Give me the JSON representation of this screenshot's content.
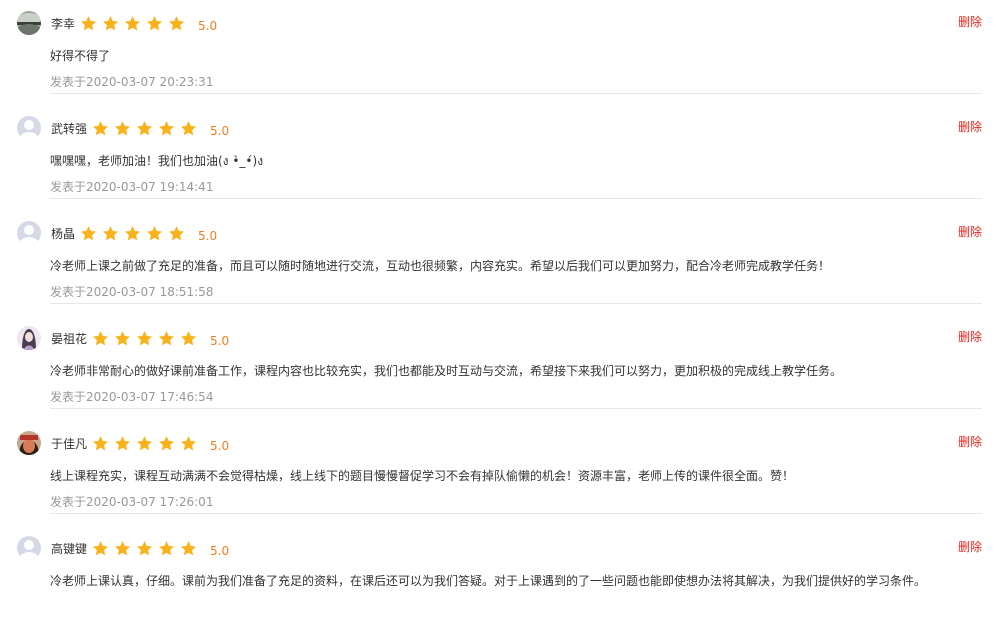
{
  "colors": {
    "star": "#f8b21c",
    "score": "#f07e22",
    "delete": "#e0251c",
    "meta": "#999999",
    "divider": "#e8e8e8"
  },
  "icons": {
    "rating": "star-icon",
    "avatar": "avatar-image"
  },
  "reviews": [
    {
      "name": "李幸",
      "rating": 5,
      "score": "5.0",
      "content": "好得不得了",
      "time": "发表于2020-03-07 20:23:31",
      "delete_label": "删除"
    },
    {
      "name": "武转强",
      "rating": 5,
      "score": "5.0",
      "content": "嘿嘿嘿，老师加油！我们也加油(ง •̀_•́)ง",
      "time": "发表于2020-03-07 19:14:41",
      "delete_label": "删除"
    },
    {
      "name": "杨晶",
      "rating": 5,
      "score": "5.0",
      "content": "冷老师上课之前做了充足的准备，而且可以随时随地进行交流，互动也很频繁，内容充实。希望以后我们可以更加努力，配合冷老师完成教学任务！",
      "time": "发表于2020-03-07 18:51:58",
      "delete_label": "删除"
    },
    {
      "name": "晏祖花",
      "rating": 5,
      "score": "5.0",
      "content": "冷老师非常耐心的做好课前准备工作，课程内容也比较充实，我们也都能及时互动与交流，希望接下来我们可以努力，更加积极的完成线上教学任务。",
      "time": "发表于2020-03-07 17:46:54",
      "delete_label": "删除"
    },
    {
      "name": "于佳凡",
      "rating": 5,
      "score": "5.0",
      "content": "线上课程充实，课程互动满满不会觉得枯燥，线上线下的题目慢慢督促学习不会有掉队偷懒的机会！资源丰富，老师上传的课件很全面。赞！",
      "time": "发表于2020-03-07 17:26:01",
      "delete_label": "删除"
    },
    {
      "name": "高键键",
      "rating": 5,
      "score": "5.0",
      "content": "冷老师上课认真，仔细。课前为我们准备了充足的资料，在课后还可以为我们答疑。对于上课遇到的了一些问题也能即使想办法将其解决，为我们提供好的学习条件。",
      "time": "",
      "delete_label": "删除"
    }
  ]
}
